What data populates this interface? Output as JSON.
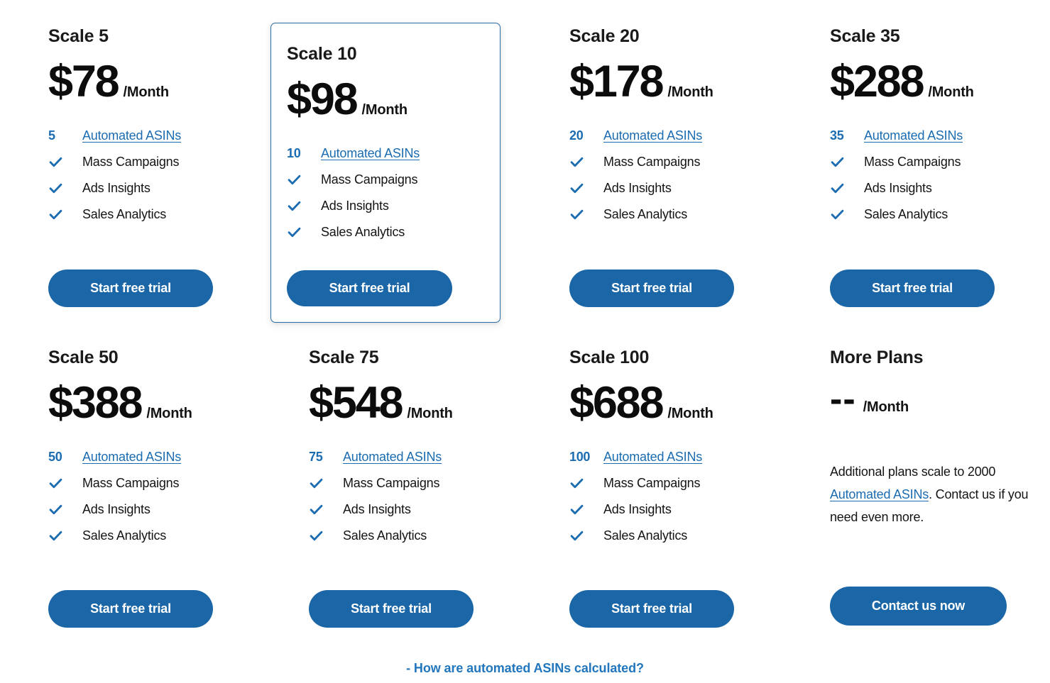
{
  "page": {
    "background": "#ffffff",
    "accent_blue": "#1b66a6",
    "link_blue": "#1b6cb0",
    "featured_border": "#2e6ca4",
    "per_month_suffix": "/Month"
  },
  "plans": [
    {
      "name": "Scale 5",
      "price": "$78",
      "per": "/Month",
      "featured": false,
      "asin_count": "5",
      "asin_label": "Automated ASINs",
      "features": [
        "Mass Campaigns",
        "Ads Insights",
        "Sales Analytics"
      ],
      "cta": "Start free trial"
    },
    {
      "name": "Scale 10",
      "price": "$98",
      "per": "/Month",
      "featured": true,
      "asin_count": "10",
      "asin_label": "Automated ASINs",
      "features": [
        "Mass Campaigns",
        "Ads Insights",
        "Sales Analytics"
      ],
      "cta": "Start free trial"
    },
    {
      "name": "Scale 20",
      "price": "$178",
      "per": "/Month",
      "featured": false,
      "asin_count": "20",
      "asin_label": "Automated ASINs",
      "features": [
        "Mass Campaigns",
        "Ads Insights",
        "Sales Analytics"
      ],
      "cta": "Start free trial"
    },
    {
      "name": "Scale 35",
      "price": "$288",
      "per": "/Month",
      "featured": false,
      "asin_count": "35",
      "asin_label": "Automated ASINs",
      "features": [
        "Mass Campaigns",
        "Ads Insights",
        "Sales Analytics"
      ],
      "cta": "Start free trial"
    },
    {
      "name": "Scale 50",
      "price": "$388",
      "per": "/Month",
      "featured": false,
      "asin_count": "50",
      "asin_label": "Automated ASINs",
      "features": [
        "Mass Campaigns",
        "Ads Insights",
        "Sales Analytics"
      ],
      "cta": "Start free trial"
    },
    {
      "name": "Scale 75",
      "price": "$548",
      "per": "/Month",
      "featured": false,
      "asin_count": "75",
      "asin_label": "Automated ASINs",
      "features": [
        "Mass Campaigns",
        "Ads Insights",
        "Sales Analytics"
      ],
      "cta": "Start free trial"
    },
    {
      "name": "Scale 100",
      "price": "$688",
      "per": "/Month",
      "featured": false,
      "asin_count": "100",
      "asin_label": "Automated ASINs",
      "features": [
        "Mass Campaigns",
        "Ads Insights",
        "Sales Analytics"
      ],
      "cta": "Start free trial"
    }
  ],
  "more_plans": {
    "name": "More Plans",
    "price": "--",
    "per": "/Month",
    "note_before": "Additional plans scale to 2000 ",
    "note_link": "Automated ASINs",
    "note_after": ". Contact us if you need even more.",
    "cta": "Contact us now"
  },
  "footer": {
    "link": "- How are automated ASINs calculated?"
  }
}
